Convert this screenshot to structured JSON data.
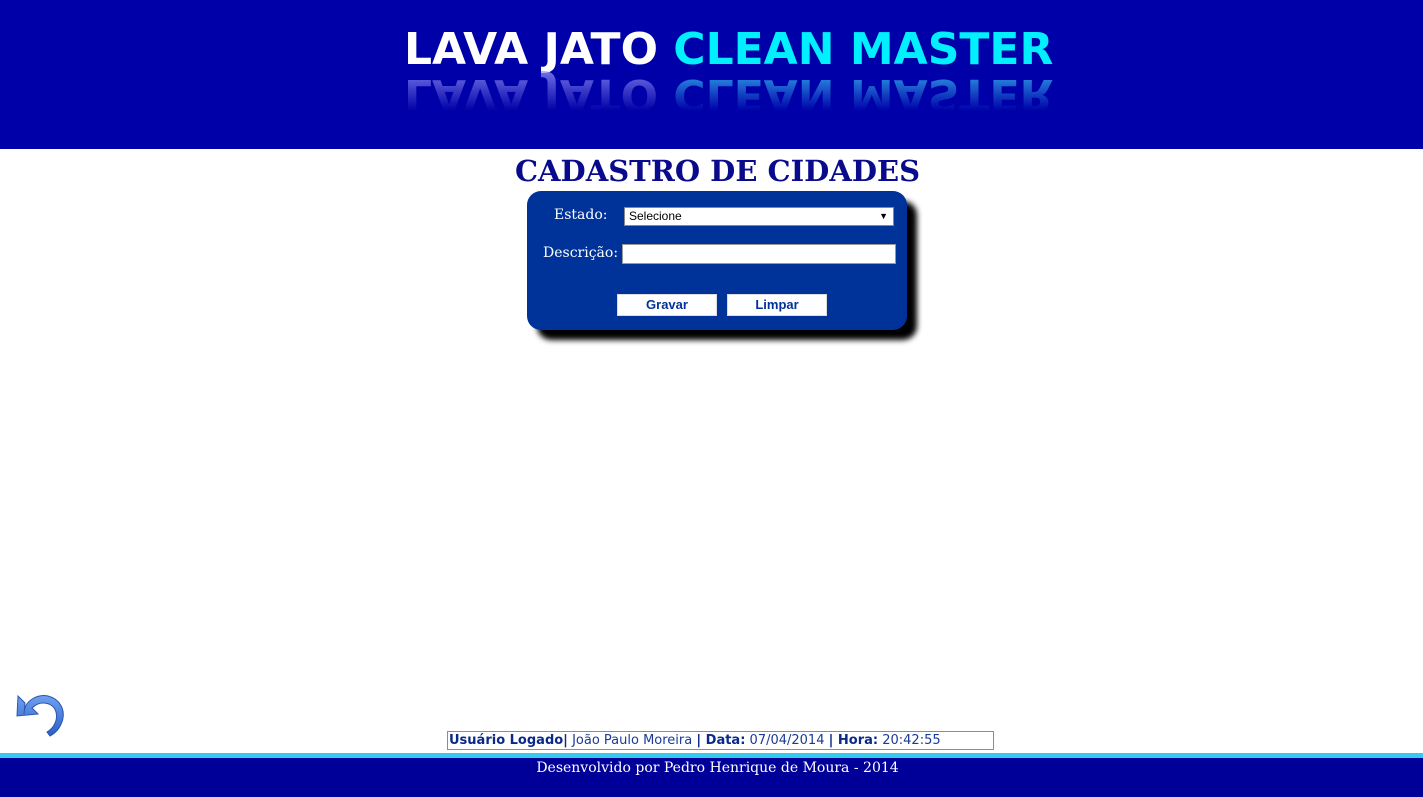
{
  "header": {
    "logo": {
      "part1": "LAVA JATO",
      "part2": "CLEAN MASTER"
    }
  },
  "main": {
    "title": "CADASTRO DE CIDADES",
    "form": {
      "estado_label": "Estado:",
      "estado_selected": "Selecione",
      "descricao_label": "Descrição:",
      "descricao_value": "",
      "gravar_label": "Gravar",
      "limpar_label": "Limpar"
    }
  },
  "status": {
    "user_label": "Usuário Logado|",
    "user_value": "João Paulo Moreira",
    "date_label": "| Data:",
    "date_value": "07/04/2014",
    "time_label": "| Hora:",
    "time_value": "20:42:55"
  },
  "footer": {
    "credit": "Desenvolvido por Pedro Henrique de Moura - 2014"
  },
  "icons": {
    "back": "back-arrow-icon",
    "dropdown": "chevron-down-icon"
  },
  "colors": {
    "header_bg": "#0000a8",
    "logo_accent": "#00f0ff",
    "panel_bg": "#003399",
    "title": "#0a0a8c",
    "footer_bg": "#000099",
    "footer_stripe": "#33ccee"
  }
}
